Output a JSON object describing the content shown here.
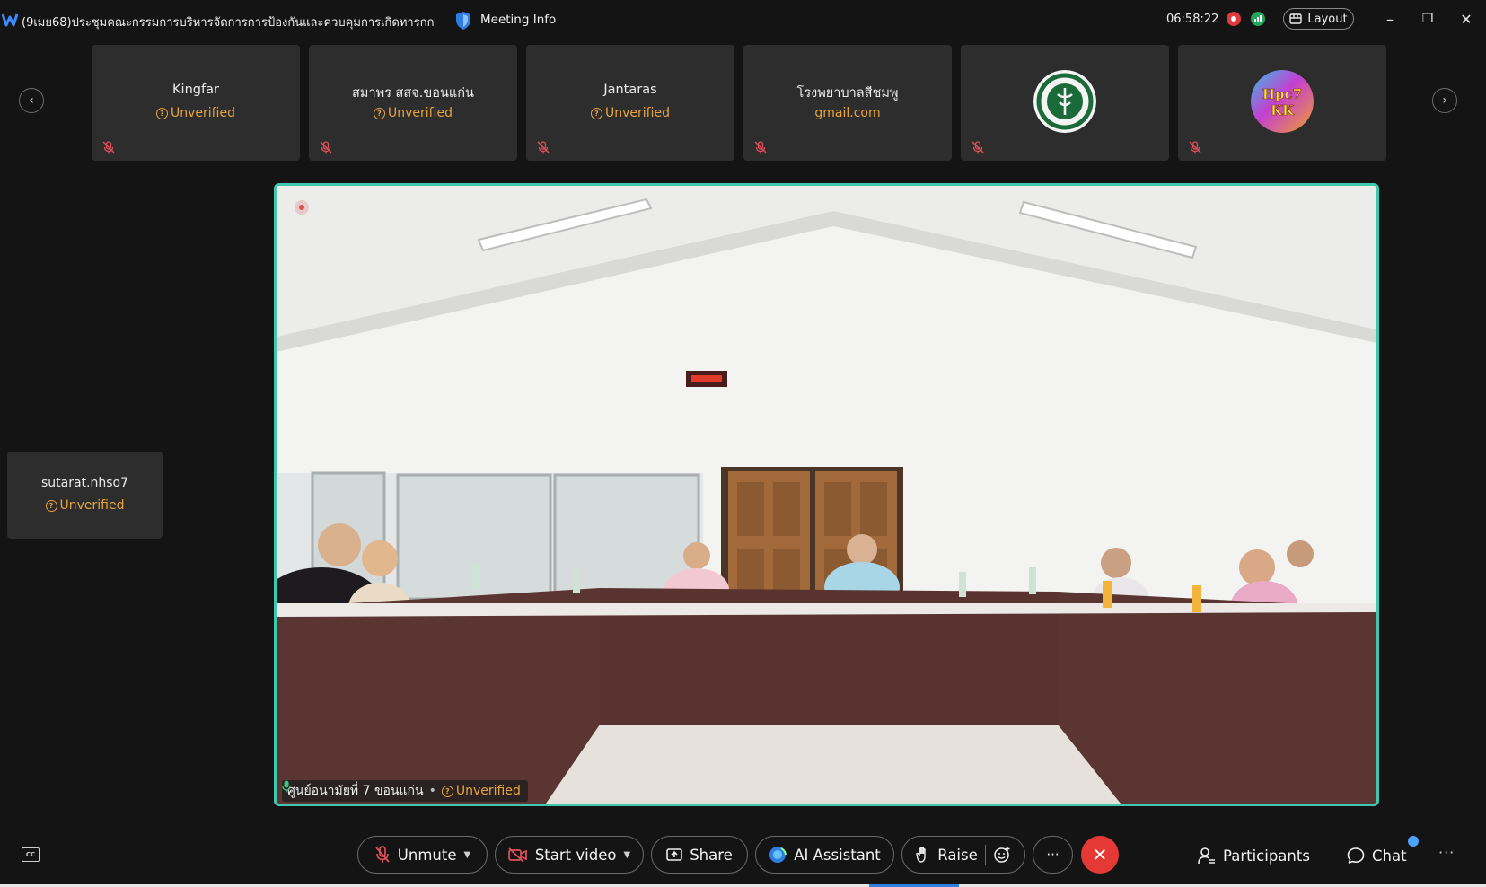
{
  "titlebar": {
    "meeting_title": "(9เมย68)ประชุมคณะกรรมการบริหารจัดการการป้องกันและควบคุมการเกิดทารกกลุ...",
    "meeting_info": "Meeting Info",
    "timer": "06:58:22",
    "layout_label": "Layout",
    "minimize": "–",
    "restore": "❐",
    "close": "✕"
  },
  "thumbnails": [
    {
      "name": "Kingfar",
      "status": "Unverified",
      "icon": "mic-muted-icon"
    },
    {
      "name": "สมาพร สสจ.ขอนแก่น",
      "status": "Unverified",
      "icon": "mic-muted-icon"
    },
    {
      "name": "Jantaras",
      "status": "Unverified",
      "icon": "mic-muted-icon"
    },
    {
      "name": "โรงพยาบาลสีชมพู",
      "status": "gmail.com",
      "icon": "mic-muted-icon"
    },
    {
      "avatar": "ministry-of-public-health-logo",
      "icon": "mic-muted-icon"
    },
    {
      "avatar": "hpc7-kk-logo",
      "avatar_text": "Hpc7 KK",
      "icon": "mic-muted-icon"
    }
  ],
  "side_participant": {
    "name": "sutarat.nhso7",
    "status": "Unverified"
  },
  "main_video": {
    "speaker_name": "ศูนย์อนามัยที่ 7 ขอนแก่น",
    "separator": "•",
    "status": "Unverified"
  },
  "toolbar": {
    "unmute": "Unmute",
    "start_video": "Start video",
    "share": "Share",
    "ai_assistant": "AI Assistant",
    "raise": "Raise",
    "more": "···",
    "end": "✕",
    "participants": "Participants",
    "chat": "Chat",
    "more_right": "···",
    "cc": "CC"
  },
  "colors": {
    "background": "#141414",
    "tile": "#2d2d2d",
    "unverified": "#e8a33d",
    "active_border": "#3fc7b0",
    "end_call": "#e53935",
    "badge": "#4da3ff"
  }
}
